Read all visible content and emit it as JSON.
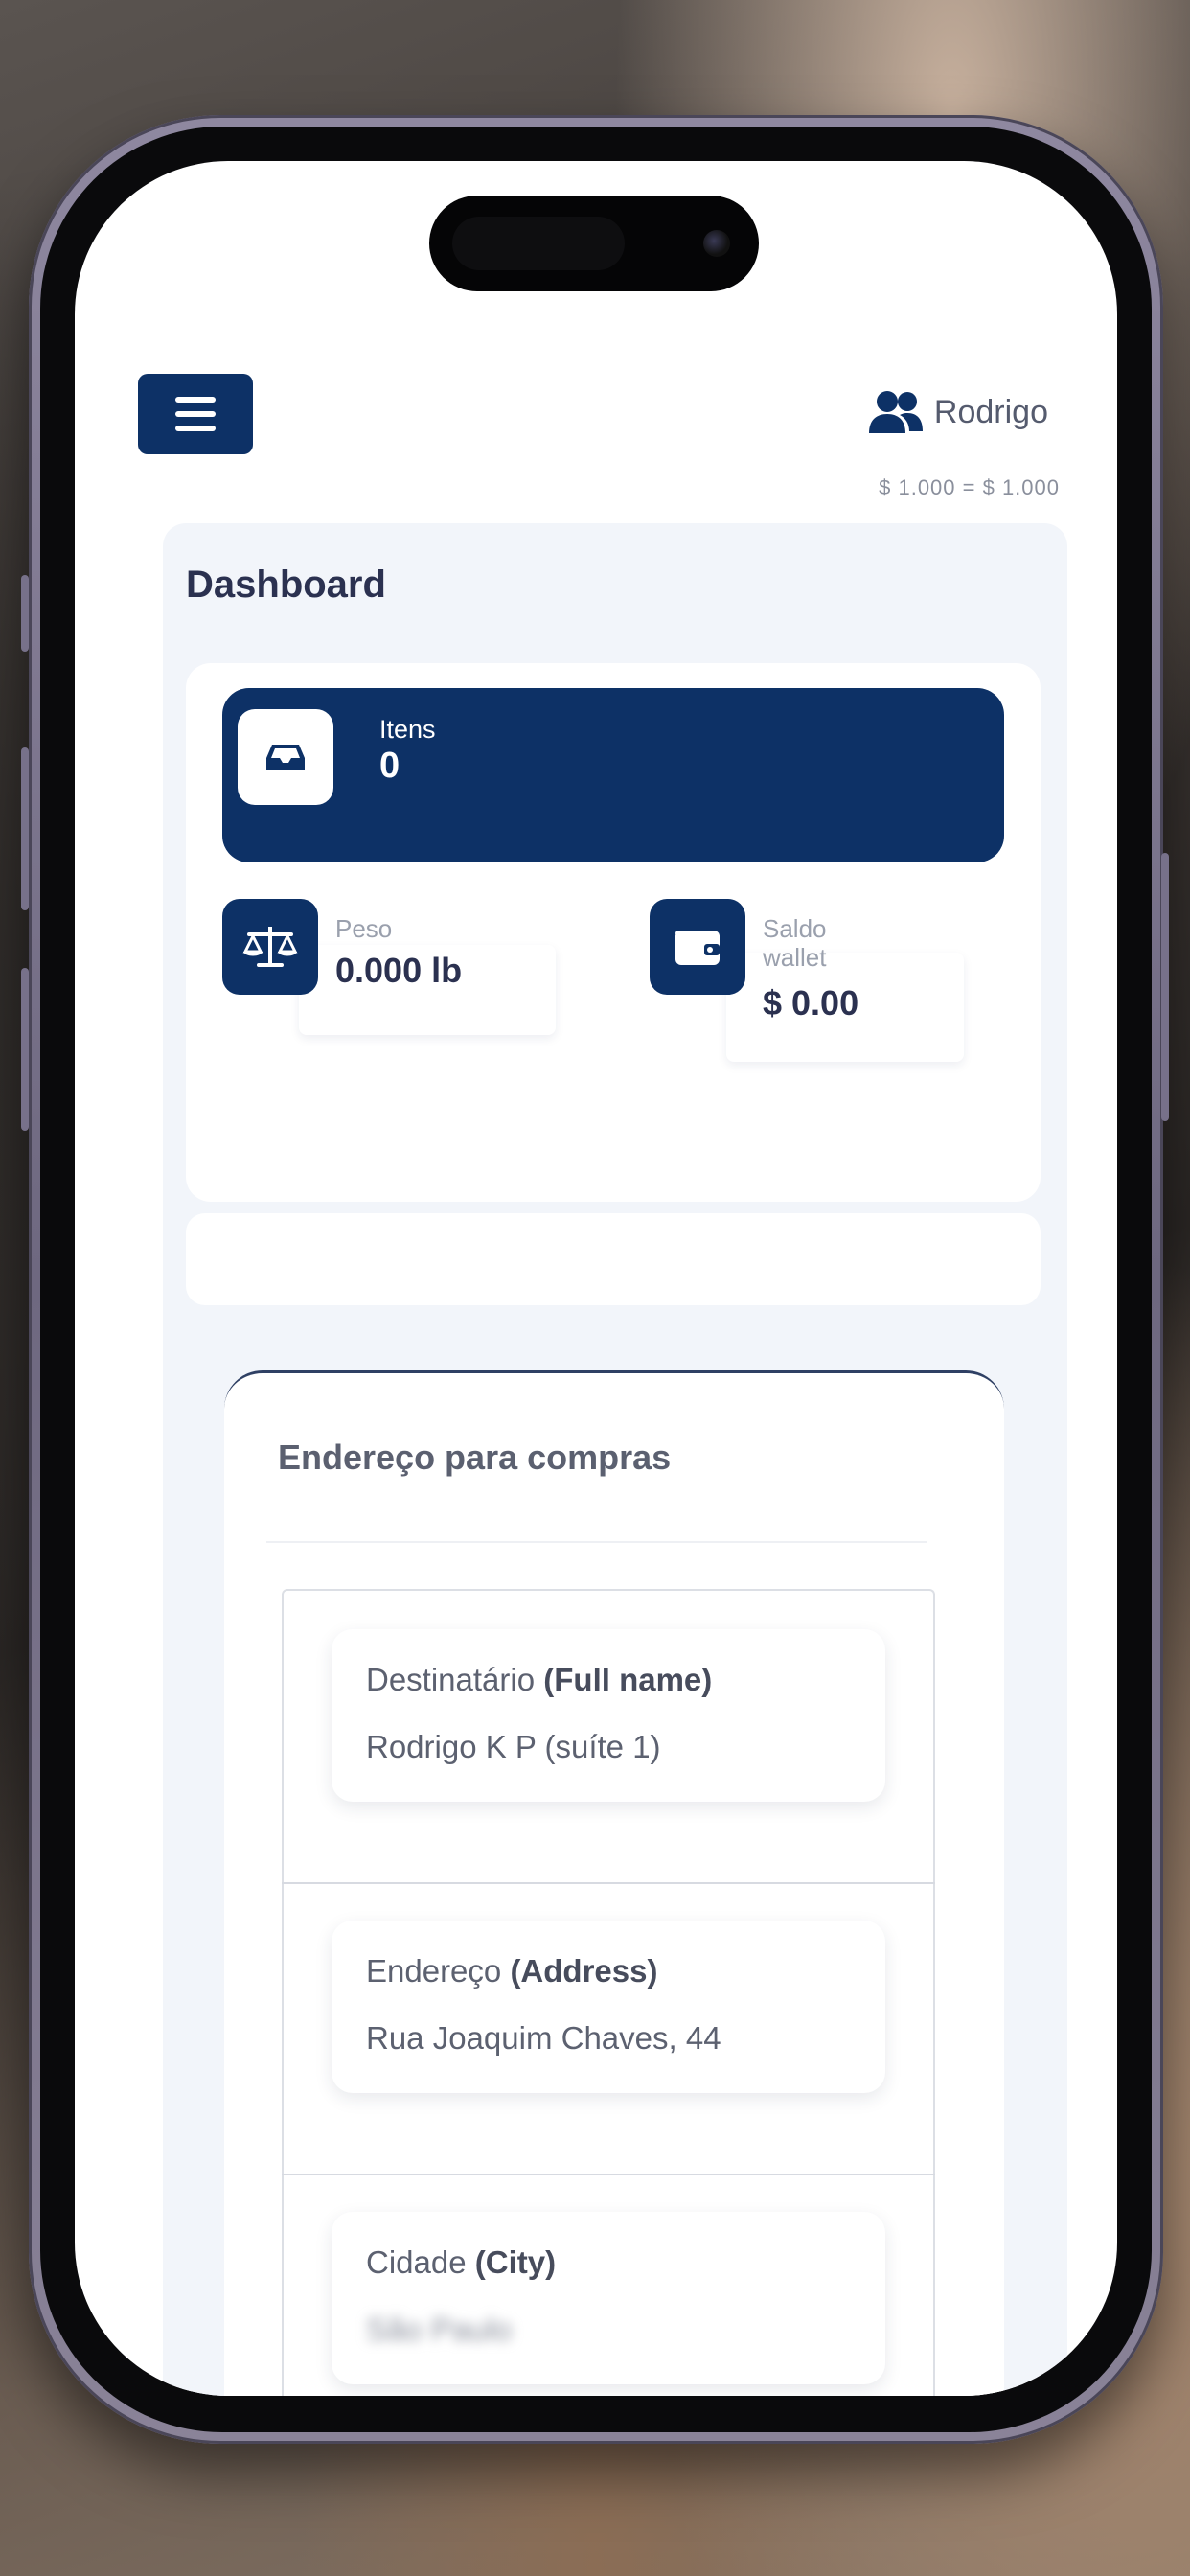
{
  "header": {
    "user_name": "Rodrigo",
    "exchange_rate": "$ 1.000  =  $ 1.000"
  },
  "dashboard": {
    "title": "Dashboard",
    "items": {
      "label": "Itens",
      "value": "0"
    },
    "weight": {
      "label": "Peso",
      "value": "0.000 lb"
    },
    "wallet": {
      "label_line1": "Saldo",
      "label_line2": "wallet",
      "value": "$ 0.00"
    }
  },
  "address": {
    "title": "Endereço para compras",
    "fields": [
      {
        "label": "Destinatário",
        "label_en": "(Full name)",
        "value": "Rodrigo K P (suíte 1)"
      },
      {
        "label": "Endereço",
        "label_en": "(Address)",
        "value": "Rua Joaquim Chaves, 44"
      },
      {
        "label": "Cidade",
        "label_en": "(City)",
        "value": "São Paulo"
      }
    ]
  },
  "icons": [
    "menu-icon",
    "users-icon",
    "inbox-icon",
    "scale-icon",
    "wallet-icon"
  ],
  "colors": {
    "primary": "#0d3166",
    "panel": "#f2f5fa",
    "text": "#2b3150"
  }
}
